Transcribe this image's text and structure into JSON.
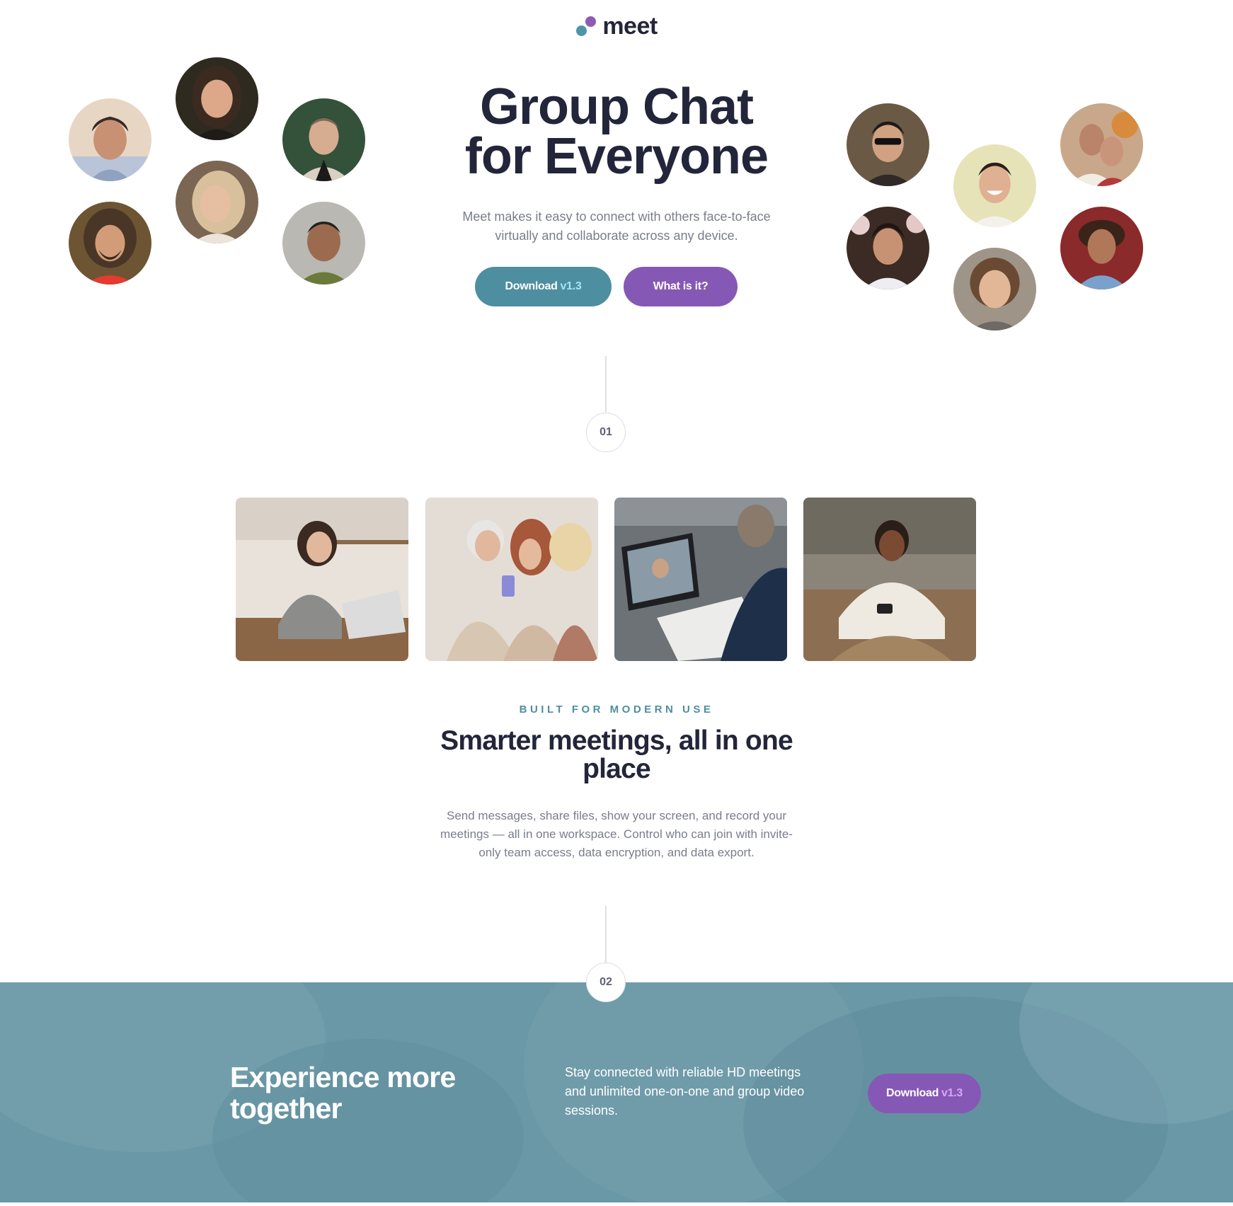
{
  "logo": {
    "text": "meet",
    "colors": {
      "dot1": "#4d96a9",
      "dot2": "#8d5bb3"
    }
  },
  "hero": {
    "title_line1": "Group Chat",
    "title_line2": "for Everyone",
    "subtitle": "Meet makes it easy to connect with others face-to-face virtually and collaborate across any device.",
    "download_label": "Download",
    "download_version": "v1.3",
    "what_label": "What is it?"
  },
  "steps": {
    "first": "01",
    "second": "02"
  },
  "features": {
    "eyebrow": "BUILT FOR MODERN USE",
    "title": "Smarter meetings, all in one place",
    "text": "Send messages, share files, show your screen, and record your meetings — all in one workspace. Control who can join with invite-only team access, data encryption, and data export."
  },
  "banner": {
    "title": "Experience more together",
    "text": "Stay connected with reliable HD meetings and unlimited one-on-one and group video sessions.",
    "download_label": "Download",
    "download_version": "v1.3"
  },
  "colors": {
    "dark": "#23263a",
    "teal": "#4e8ea1",
    "purple": "#8658b5",
    "muted": "#7a7d8c",
    "banner": "#6b98a7"
  }
}
